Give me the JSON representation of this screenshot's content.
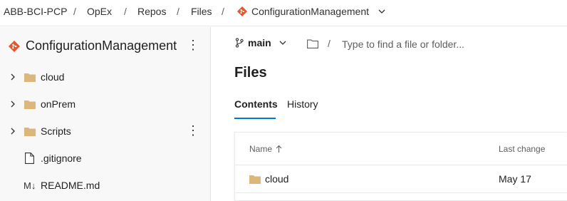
{
  "breadcrumb": {
    "org": "ABB-BCI-PCP",
    "project": "OpEx",
    "section": "Repos",
    "page": "Files",
    "repo": "ConfigurationManagement",
    "separator": "/"
  },
  "sidebar": {
    "repo_name": "ConfigurationManagement",
    "items": [
      {
        "label": "cloud",
        "kind": "folder"
      },
      {
        "label": "onPrem",
        "kind": "folder"
      },
      {
        "label": "Scripts",
        "kind": "folder"
      },
      {
        "label": ".gitignore",
        "kind": "file"
      },
      {
        "label": "README.md",
        "kind": "markdown"
      }
    ],
    "markdown_glyph": "M↓"
  },
  "toolbar": {
    "branch": "main",
    "path_separator": "/",
    "path_placeholder": "Type to find a file or folder..."
  },
  "main": {
    "title": "Files",
    "tabs": [
      {
        "label": "Contents",
        "active": true
      },
      {
        "label": "History",
        "active": false
      }
    ]
  },
  "table": {
    "headers": {
      "name": "Name",
      "last_change": "Last change"
    },
    "rows": [
      {
        "name": "cloud",
        "last_change": "May 17"
      }
    ]
  },
  "colors": {
    "accent": "#0078d4",
    "git_icon": "#e4572e",
    "folder": "#dcb67a"
  },
  "icons": {
    "repo": "git-diamond-icon",
    "branch": "branch-icon",
    "folder": "folder-icon",
    "file": "file-icon",
    "sort": "arrow-up-icon",
    "more": "kebab-menu-icon"
  }
}
